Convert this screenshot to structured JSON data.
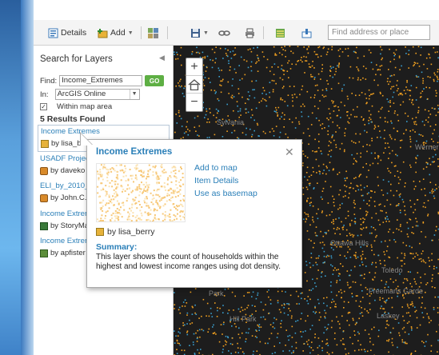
{
  "toolbar": {
    "details_label": "Details",
    "add_label": "Add",
    "search_placeholder": "Find address or place"
  },
  "panel": {
    "title": "Search for Layers",
    "find_label": "Find:",
    "find_value": "Income_Extremes",
    "go_label": "GO",
    "in_label": "In:",
    "in_value": "ArcGIS Online",
    "within_map_label": "Within map area",
    "results_count": "5 Results Found",
    "results": [
      {
        "title": "Income Extremes",
        "owner": "by lisa_be"
      },
      {
        "title": "USADF Project",
        "owner": "by daveko"
      },
      {
        "title": "ELI_by_2010_",
        "owner": "by John.C.I"
      },
      {
        "title": "Income Extrer",
        "owner": "by StoryMa"
      },
      {
        "title": "Income Extrer",
        "owner": "by apfister"
      }
    ]
  },
  "map": {
    "labels": [
      "Sylvania",
      "Werner",
      "Ottawa Hills",
      "Hill Park",
      "Park",
      "Toledo",
      "Freemans Garde",
      "Laskey"
    ]
  },
  "popup": {
    "title": "Income Extremes",
    "actions": [
      "Add to map",
      "Item Details",
      "Use as basemap"
    ],
    "owner": "by lisa_berry",
    "summary_heading": "Summary:",
    "summary": "This layer shows the count of households within the highest and lowest income ranges using dot density."
  },
  "colors": {
    "accent": "#2a7fb8",
    "go_button": "#5eaf44",
    "dot_high": "#f0a020",
    "dot_low": "#3aa0d0",
    "map_bg": "#1d1d1d"
  }
}
